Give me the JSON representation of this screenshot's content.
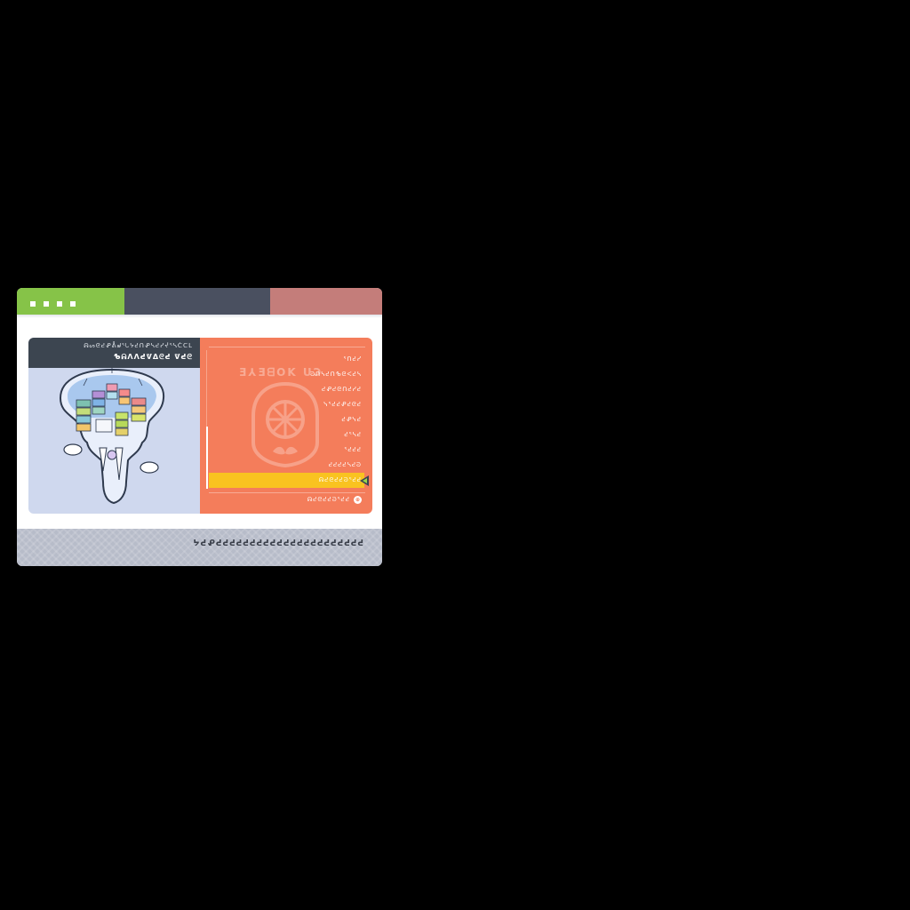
{
  "window": {
    "top_dots": [
      "▪",
      "▪",
      "▪",
      "▪"
    ],
    "colors": {
      "green": "#86c348",
      "slate": "#4a5060",
      "rose": "#c47d7a",
      "panel_orange": "#f47d5b",
      "selected_yellow": "#f9c320",
      "art_bg": "#cfd8ee",
      "header_dark": "#3c4550"
    }
  },
  "info_panel": {
    "line1": "ᕱᔕᘓᕍᕵᕔᖙᕐᘂᔭᕍᑎᕵᓴᕍᓯᔫᕐᓴᑖᑕᒪ",
    "line2": "ᕹᕱᐱᐱᕍᕓᐃᘓᕍ ᕓᕍᘓ"
  },
  "menu": {
    "watermark": "Ǝ⅄ƎᗺOK ᑌƆ",
    "items": [
      {
        "label": "ᕐᑎᕍᓯ"
      },
      {
        "label": "ᘒᑎᓴᕍᑎᕹᘓᐸᕍᓴ"
      },
      {
        "label": "ᕍᕵᕍᘓᑎᕍᓯᕍ"
      },
      {
        "label": "ᓭᕐᕍᕍᕵᕍᘓᕍ"
      },
      {
        "label": "ᕍᕵᓭᕍ"
      },
      {
        "label": "ᕍᕐᓴᕍ"
      },
      {
        "label": "ᕐᕍᕍᕍ"
      },
      {
        "label": "ᕍᕍᕍᕍᓴᕍᘒ"
      },
      {
        "label": "ᕱᕍᘓᕍᕍᘒᕐᕍᕍ",
        "selected": true
      }
    ],
    "footer_hint": "ᕱᕍᘓᕍᕍᘒᕐᕍᕍ",
    "footer_icon": "⊕"
  },
  "status": {
    "text": "ᔭᕍᕵᕍᕍᕍᕍᕍᕍᕍᕍᕍᕍᕍᕍᕍᕍᕍᕍᕍᕍᕍᕍᕍᕍ"
  }
}
